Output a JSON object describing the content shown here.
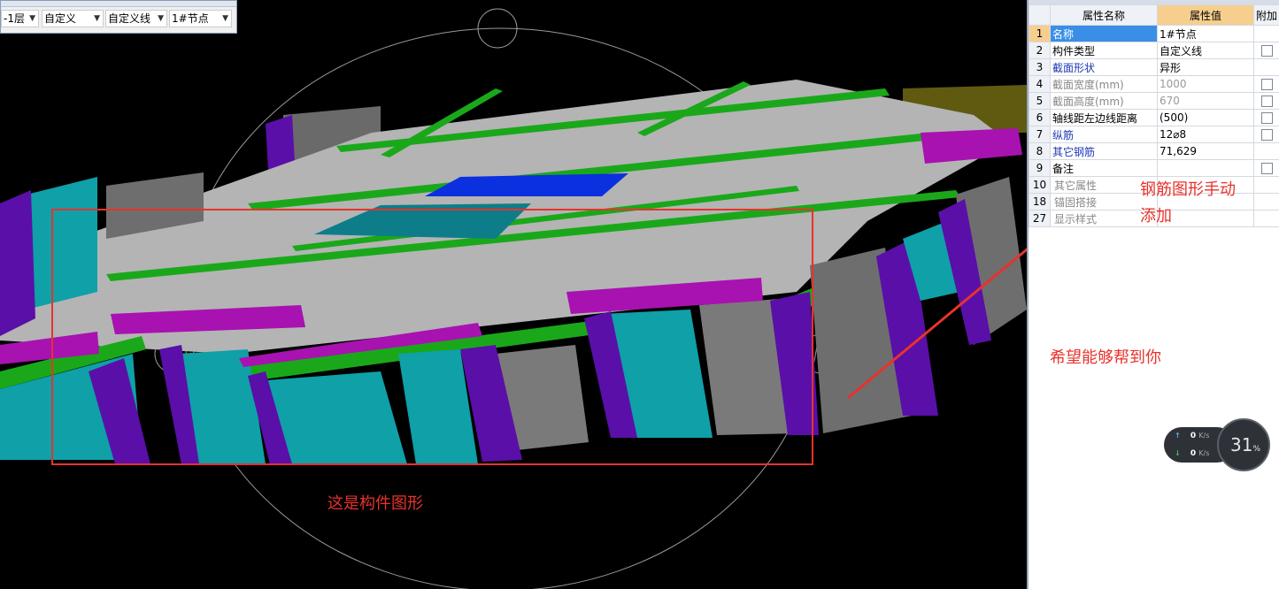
{
  "toolbar": {
    "floor_value": "-1层",
    "category_value": "自定义",
    "type_value": "自定义线",
    "component_value": "1#节点"
  },
  "properties": {
    "columns": [
      "属性名称",
      "属性值",
      "附加"
    ],
    "rows": [
      {
        "num": "1",
        "name": "名称",
        "value": "1#节点",
        "checkbox": false,
        "style": "selected"
      },
      {
        "num": "2",
        "name": "构件类型",
        "value": "自定义线",
        "checkbox": true,
        "style": "normal"
      },
      {
        "num": "3",
        "name": "截面形状",
        "value": "异形",
        "checkbox": false,
        "style": "blue"
      },
      {
        "num": "4",
        "name": "截面宽度(mm)",
        "value": "1000",
        "checkbox": true,
        "style": "gray"
      },
      {
        "num": "5",
        "name": "截面高度(mm)",
        "value": "670",
        "checkbox": true,
        "style": "gray"
      },
      {
        "num": "6",
        "name": "轴线距左边线距离",
        "value": "(500)",
        "checkbox": true,
        "style": "normal"
      },
      {
        "num": "7",
        "name": "纵筋",
        "value": "12⌀8",
        "checkbox": true,
        "style": "blue"
      },
      {
        "num": "8",
        "name": "其它钢筋",
        "value": "71,629",
        "checkbox": false,
        "style": "blue"
      },
      {
        "num": "9",
        "name": "备注",
        "value": "",
        "checkbox": true,
        "style": "normal"
      },
      {
        "num": "10",
        "name": "其它属性",
        "value": "",
        "checkbox": false,
        "style": "group",
        "expander": "+"
      },
      {
        "num": "18",
        "name": "锚固搭接",
        "value": "",
        "checkbox": false,
        "style": "group",
        "expander": "+"
      },
      {
        "num": "27",
        "name": "显示样式",
        "value": "",
        "checkbox": false,
        "style": "group",
        "expander": "+"
      }
    ]
  },
  "annotations": {
    "component_caption": "这是构件图形",
    "rebar_note_line1": "钢筋图形手动",
    "rebar_note_line2": "添加",
    "hope_text": "希望能够帮到你"
  },
  "network_widget": {
    "upload": "0",
    "download": "0",
    "unit": "K/s",
    "percent": "31",
    "percent_sign": "%"
  },
  "colors": {
    "slab": "#b4b4b4",
    "beam_green": "#1aa81a",
    "column_purple": "#5a0fa8",
    "wall_teal": "#0fa0a8",
    "wall_gray": "#7a7a7a",
    "magenta": "#a812b0",
    "opening_blue": "#0a30e0",
    "annotation_red": "#e8322b",
    "ellipse_orange": "#f0b400",
    "selection_blue": "#3a8ee6",
    "header_orange": "#f6cf8e"
  }
}
